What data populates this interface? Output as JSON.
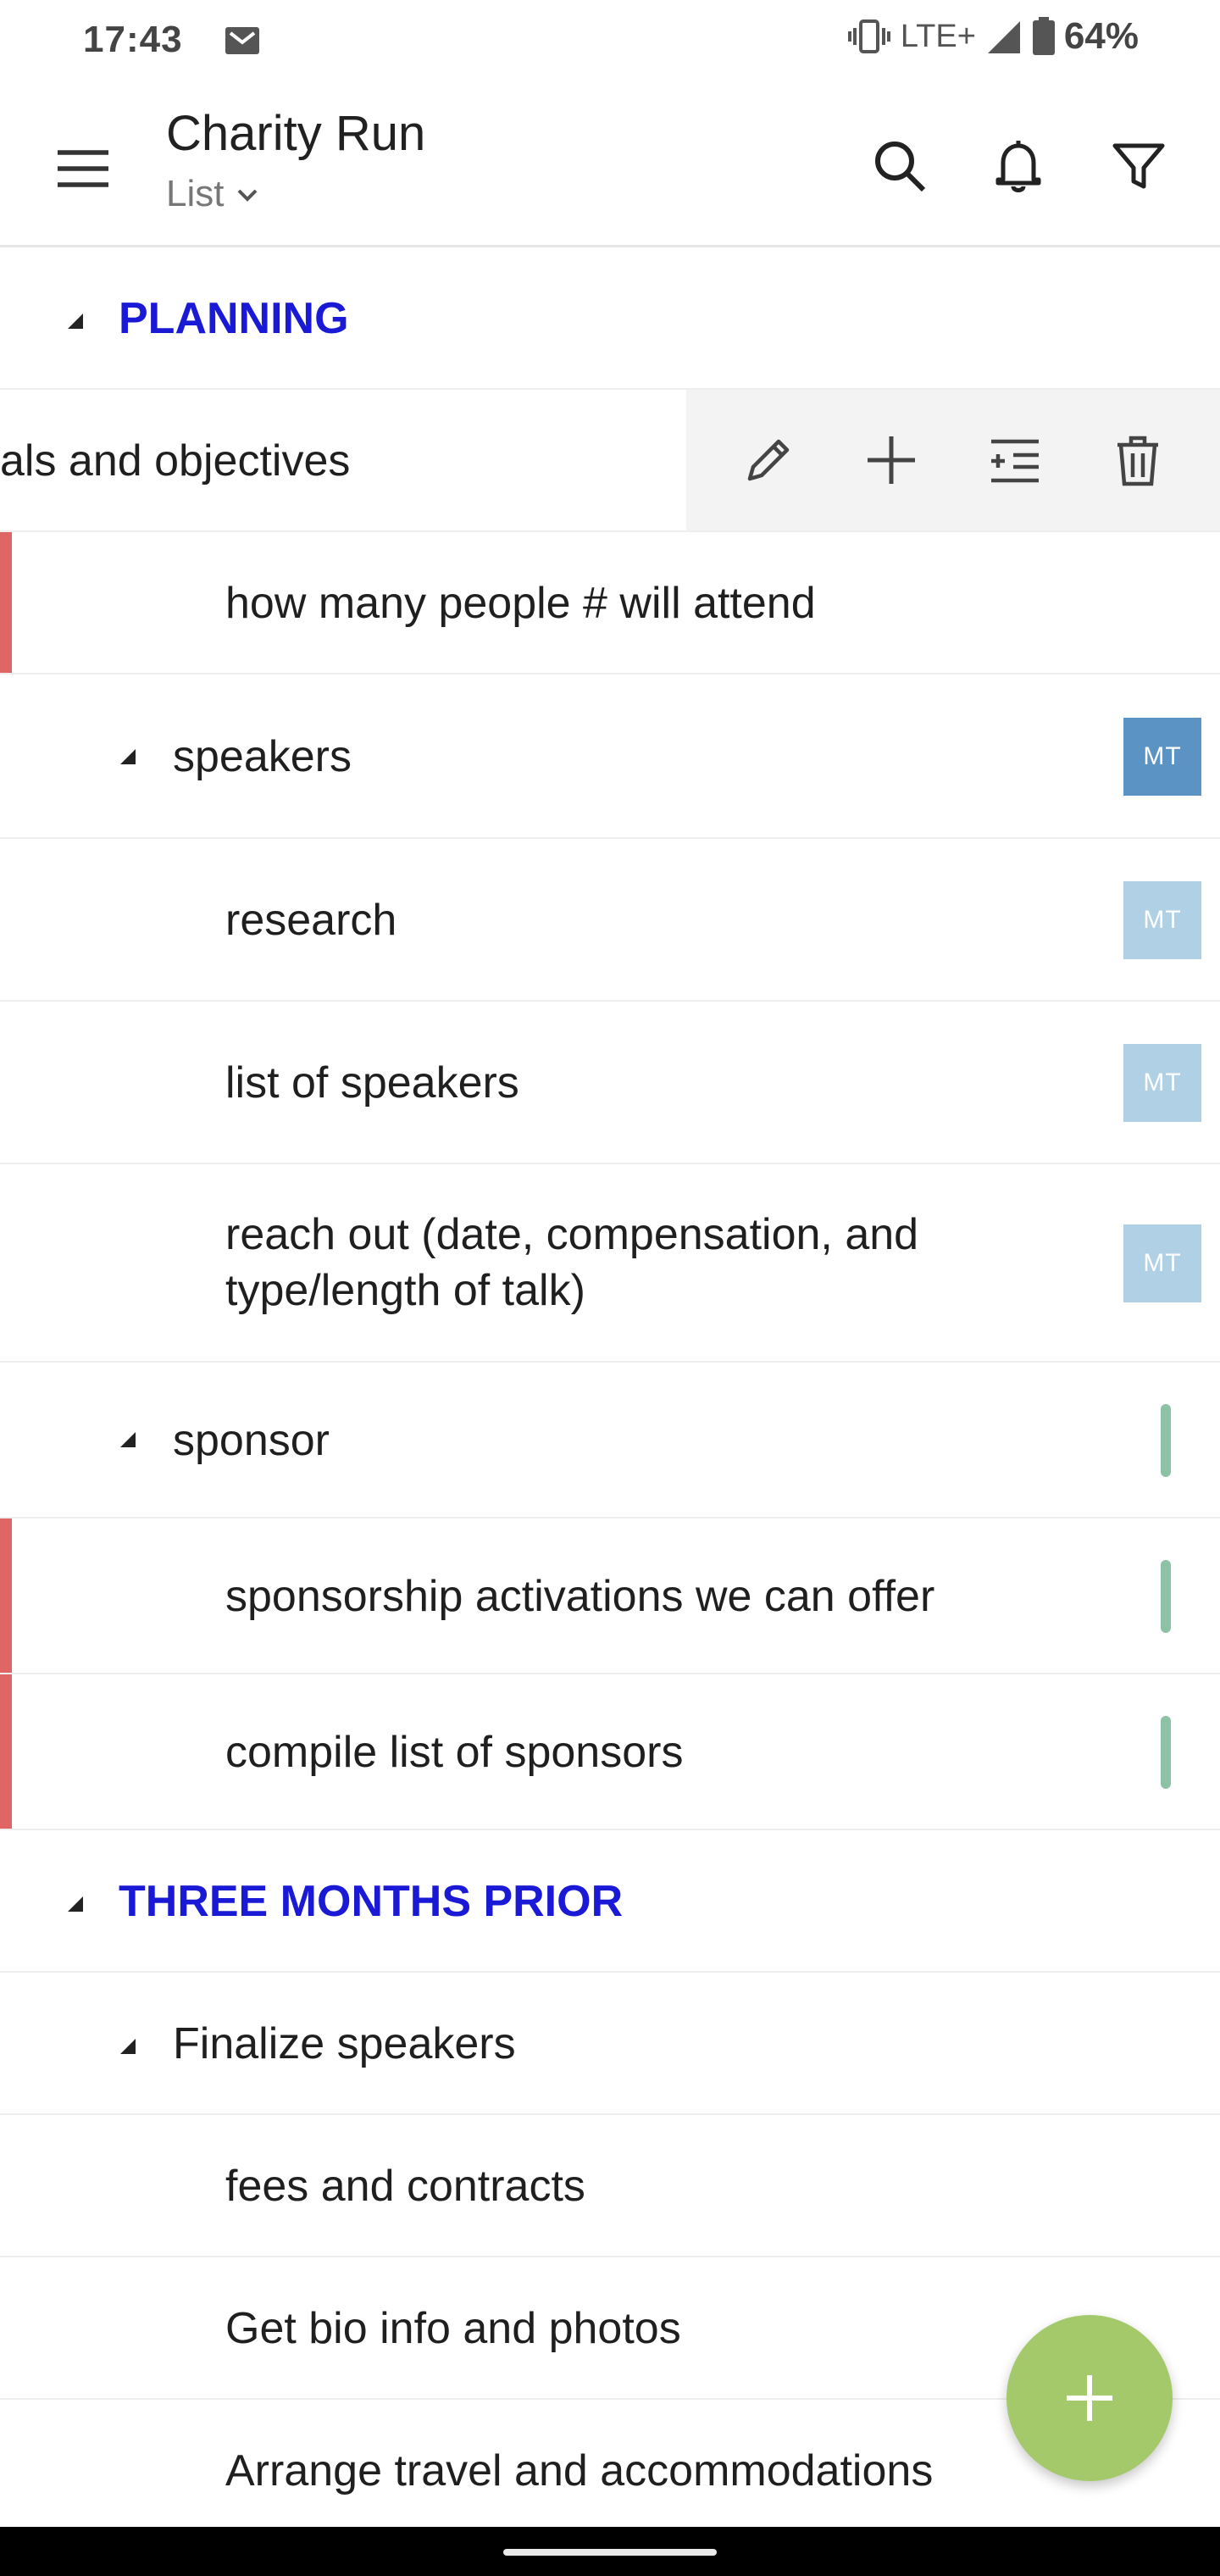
{
  "status_bar": {
    "time": "17:43",
    "network": "LTE+",
    "battery": "64%"
  },
  "app_bar": {
    "title": "Charity Run",
    "view": "List"
  },
  "colors": {
    "section": "#1a1ad6",
    "priority_flag": "#e06666",
    "avatar_assigned": "#5b93c4",
    "avatar_inherited": "#b0d0e6",
    "status_tick": "#8cc3a6",
    "fab": "#a4c96b"
  },
  "list": {
    "planning": {
      "label": "PLANNING"
    },
    "goals": {
      "label": "als and objectives"
    },
    "attend": {
      "label": "how many people # will attend"
    },
    "speakers": {
      "label": "speakers",
      "avatar": "MT"
    },
    "research": {
      "label": "research",
      "avatar": "MT"
    },
    "list_speakers": {
      "label": "list of speakers",
      "avatar": "MT"
    },
    "reach_out": {
      "label_1": "reach out (date, compensation, and",
      "label_2": "type/length of talk)",
      "avatar": "MT"
    },
    "sponsor": {
      "label": "sponsor"
    },
    "activations": {
      "label": "sponsorship activations we can offer"
    },
    "compile": {
      "label": "compile list of sponsors"
    },
    "three_months": {
      "label": "THREE MONTHS PRIOR"
    },
    "finalize": {
      "label": "Finalize speakers"
    },
    "fees": {
      "label": "fees and contracts"
    },
    "bio": {
      "label": "Get bio info and photos"
    },
    "travel": {
      "label": "Arrange travel and accommodations"
    }
  }
}
